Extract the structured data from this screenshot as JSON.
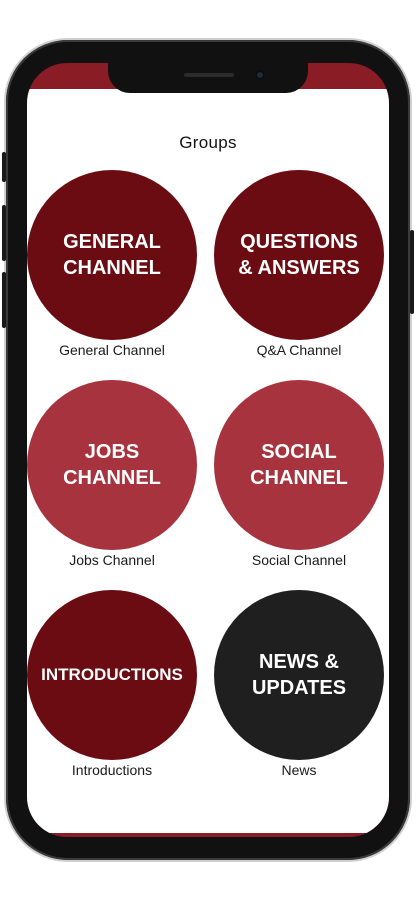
{
  "header": {
    "title": "Groups"
  },
  "groups": [
    {
      "circle_text": "GENERAL\nCHANNEL",
      "label": "General Channel",
      "color": "#6b0b12"
    },
    {
      "circle_text": "QUESTIONS\n& ANSWERS",
      "label": "Q&A Channel",
      "color": "#6b0b12"
    },
    {
      "circle_text": "JOBS\nCHANNEL",
      "label": "Jobs Channel",
      "color": "#a6333d"
    },
    {
      "circle_text": "SOCIAL\nCHANNEL",
      "label": "Social Channel",
      "color": "#a6333d"
    },
    {
      "circle_text": "INTRODUCTIONS",
      "label": "Introductions",
      "color": "#6b0b12"
    },
    {
      "circle_text": "NEWS &\nUPDATES",
      "label": "News",
      "color": "#1f1f1f"
    }
  ],
  "theme": {
    "accent": "#8a1c26"
  }
}
